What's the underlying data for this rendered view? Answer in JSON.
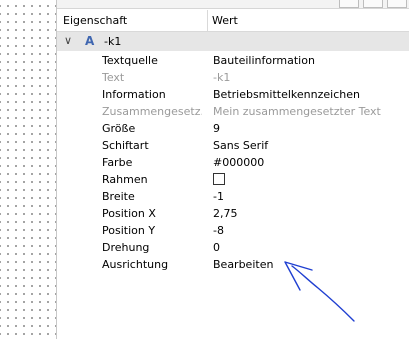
{
  "header": {
    "col_property": "Eigenschaft",
    "col_value": "Wert"
  },
  "group": {
    "label": "-k1",
    "expanded": true
  },
  "rows": [
    {
      "key": "Textquelle",
      "value": "Bauteilinformation",
      "dim": false
    },
    {
      "key": "Text",
      "value": "-k1",
      "dim": true
    },
    {
      "key": "Information",
      "value": "Betriebsmittelkennzeichen",
      "dim": false
    },
    {
      "key": "Zusammengesetz...",
      "value": "Mein zusammengesetzter Text",
      "dim": true
    },
    {
      "key": "Größe",
      "value": "9",
      "dim": false
    },
    {
      "key": "Schiftart",
      "value": "Sans Serif",
      "dim": false
    },
    {
      "key": "Farbe",
      "value": "#000000",
      "dim": false
    },
    {
      "key": "Rahmen",
      "value": "",
      "dim": false,
      "checkbox": true,
      "checked": false
    },
    {
      "key": "Breite",
      "value": "-1",
      "dim": false
    },
    {
      "key": "Position X",
      "value": "2,75",
      "dim": false
    },
    {
      "key": "Position Y",
      "value": "-8",
      "dim": false
    },
    {
      "key": "Drehung",
      "value": "0",
      "dim": false
    },
    {
      "key": "Ausrichtung",
      "value": "Bearbeiten",
      "dim": false
    }
  ],
  "colors": {
    "group_bg": "#e6e6e6",
    "dim_text": "#9a9a9a",
    "annotation": "#1f3fd1"
  }
}
